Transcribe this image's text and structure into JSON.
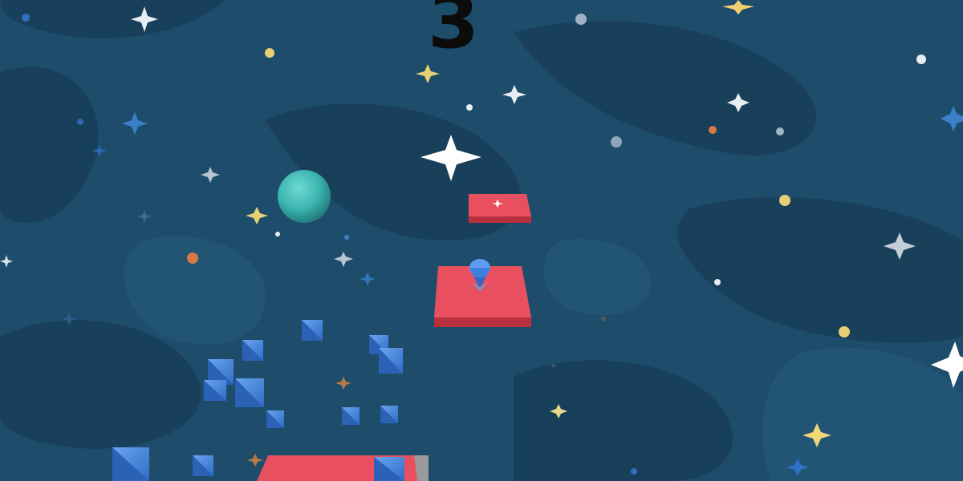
{
  "hud": {
    "score": "3"
  },
  "colors": {
    "background": "#1e4d6b",
    "platform_top": "#e8505f",
    "platform_side": "#b8303d",
    "ball": "#3bb5b0",
    "shard": "#3f82dd",
    "player": "#3b7fe0"
  },
  "scene": {
    "ball_icon": "teal-sphere",
    "player_icon": "blue-gem-character",
    "platforms": [
      "far-platform",
      "mid-platform",
      "near-platform"
    ],
    "pickup_icon": "small-star"
  }
}
